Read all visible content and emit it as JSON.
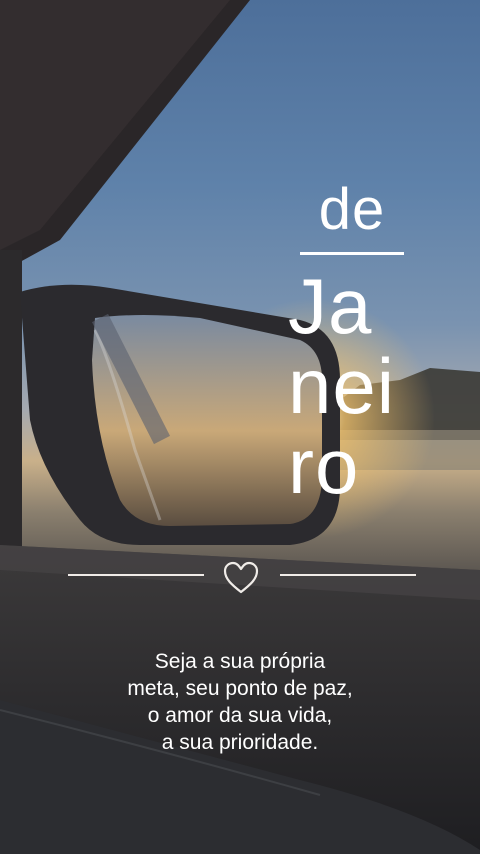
{
  "title": {
    "prefix": "de",
    "lines": [
      "Ja",
      "nei",
      "ro"
    ]
  },
  "quote": {
    "lines": [
      "Seja a sua própria",
      "meta, seu ponto de paz,",
      "o amor da sua vida,",
      "a sua prioridade."
    ]
  },
  "icons": {
    "divider_icon": "heart-outline-icon"
  },
  "colors": {
    "text": "#ffffff",
    "sky": "#5f82aa",
    "sun": "#f6c56c"
  }
}
